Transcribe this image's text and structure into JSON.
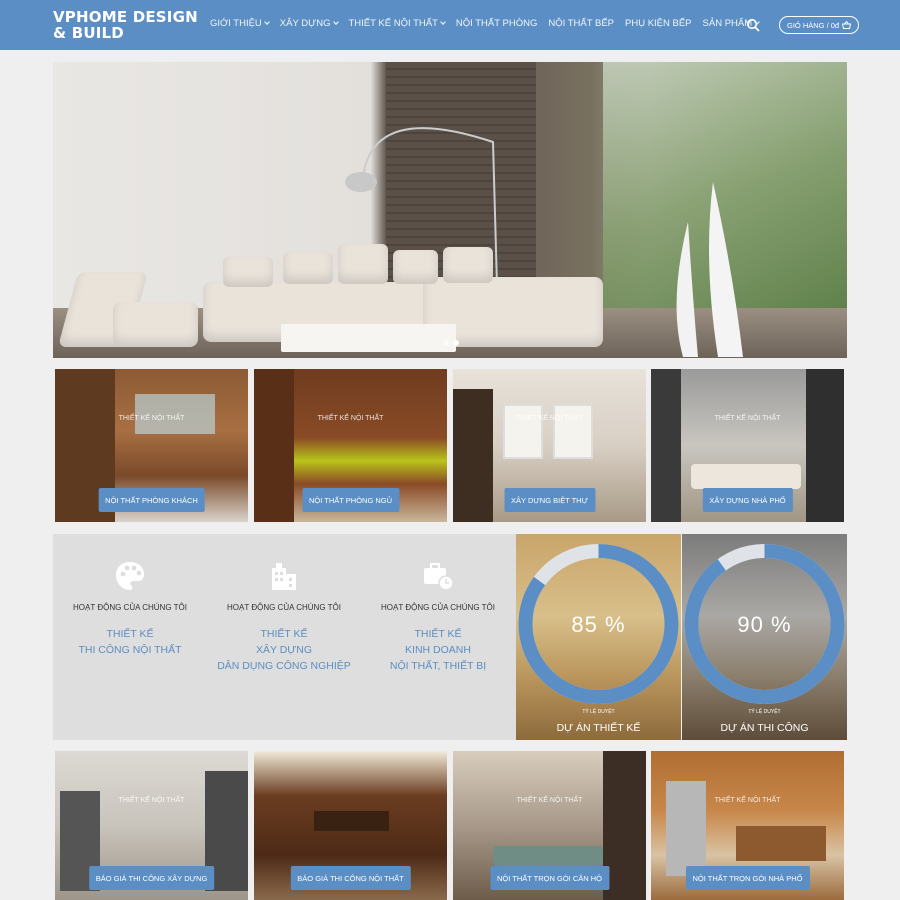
{
  "header": {
    "logo_line1": "VPHOME DESIGN",
    "logo_line2": "& BUILD",
    "nav": [
      {
        "label": "GIỚI THIỆU",
        "has_dropdown": true
      },
      {
        "label": "XÂY DỰNG",
        "has_dropdown": true
      },
      {
        "label": "THIẾT KẾ NỘI THẤT",
        "has_dropdown": true
      },
      {
        "label": "NỘI THẤT PHÒNG",
        "has_dropdown": false
      },
      {
        "label": "NỘI THẤT BẾP",
        "has_dropdown": false
      },
      {
        "label": "PHỤ KIỆN BẾP",
        "has_dropdown": false
      },
      {
        "label": "SẢN PHẨM",
        "has_dropdown": true
      }
    ],
    "search_icon": "search-icon",
    "cart_label": "GIỎ HÀNG / 0đ",
    "cart_icon": "basket-icon"
  },
  "colors": {
    "brand": "#5b8ec4",
    "background": "#efefef",
    "panel": "#dedede"
  },
  "row1": [
    {
      "overlay": "THIẾT KẾ NỘI THẤT",
      "button": "NỘI THẤT PHÒNG KHÁCH"
    },
    {
      "overlay": "THIẾT KẾ NỘI THẤT",
      "button": "NỘI THẤT PHÒNG NGỦ"
    },
    {
      "overlay": "THIẾT KẾ NỘI THẤT",
      "button": "XÂY DỰNG BIỆT THỰ"
    },
    {
      "overlay": "THIẾT KẾ NỘI THẤT",
      "button": "XÂY DỰNG NHÀ PHỐ"
    }
  ],
  "activities": [
    {
      "icon": "palette-icon",
      "heading": "HOẠT ĐỘNG CỦA CHÚNG TÔI",
      "lines": [
        "THIẾT KẾ",
        "THI CÔNG NỘI THẤT"
      ]
    },
    {
      "icon": "buildings-icon",
      "heading": "HOẠT ĐỘNG CỦA CHÚNG TÔI",
      "lines": [
        "THIẾT KẾ",
        "XÂY DỰNG",
        "DÂN DỤNG CÔNG NGHIỆP"
      ]
    },
    {
      "icon": "briefcase-clock-icon",
      "heading": "HOẠT ĐỘNG CỦA CHÚNG TÔI",
      "lines": [
        "THIẾT KẾ",
        "KINH DOANH",
        "NỘI THẤT, THIẾT BỊ"
      ]
    }
  ],
  "stats": [
    {
      "percent_label": "85 %",
      "value": 85,
      "sub": "TỶ LỆ DUYỆT",
      "title": "DỰ ÁN THIẾT KẾ"
    },
    {
      "percent_label": "90 %",
      "value": 90,
      "sub": "TỶ LỆ DUYỆT",
      "title": "DỰ ÁN THI CÔNG"
    }
  ],
  "row2": [
    {
      "overlay": "THIẾT KẾ NỘI THẤT",
      "button": "BÁO GIÁ THI CÔNG XÂY DỰNG"
    },
    {
      "overlay": "",
      "button": "BÁO GIÁ THI CÔNG NỘI THẤT"
    },
    {
      "overlay": "THIẾT KẾ NỘI THẤT",
      "button": "NỘI THẤT TRỌN GÓI CĂN HỘ"
    },
    {
      "overlay": "THIẾT KẾ NỘI THẤT",
      "button": "NỘI THẤT TRỌN GÓI NHÀ PHỐ"
    }
  ]
}
